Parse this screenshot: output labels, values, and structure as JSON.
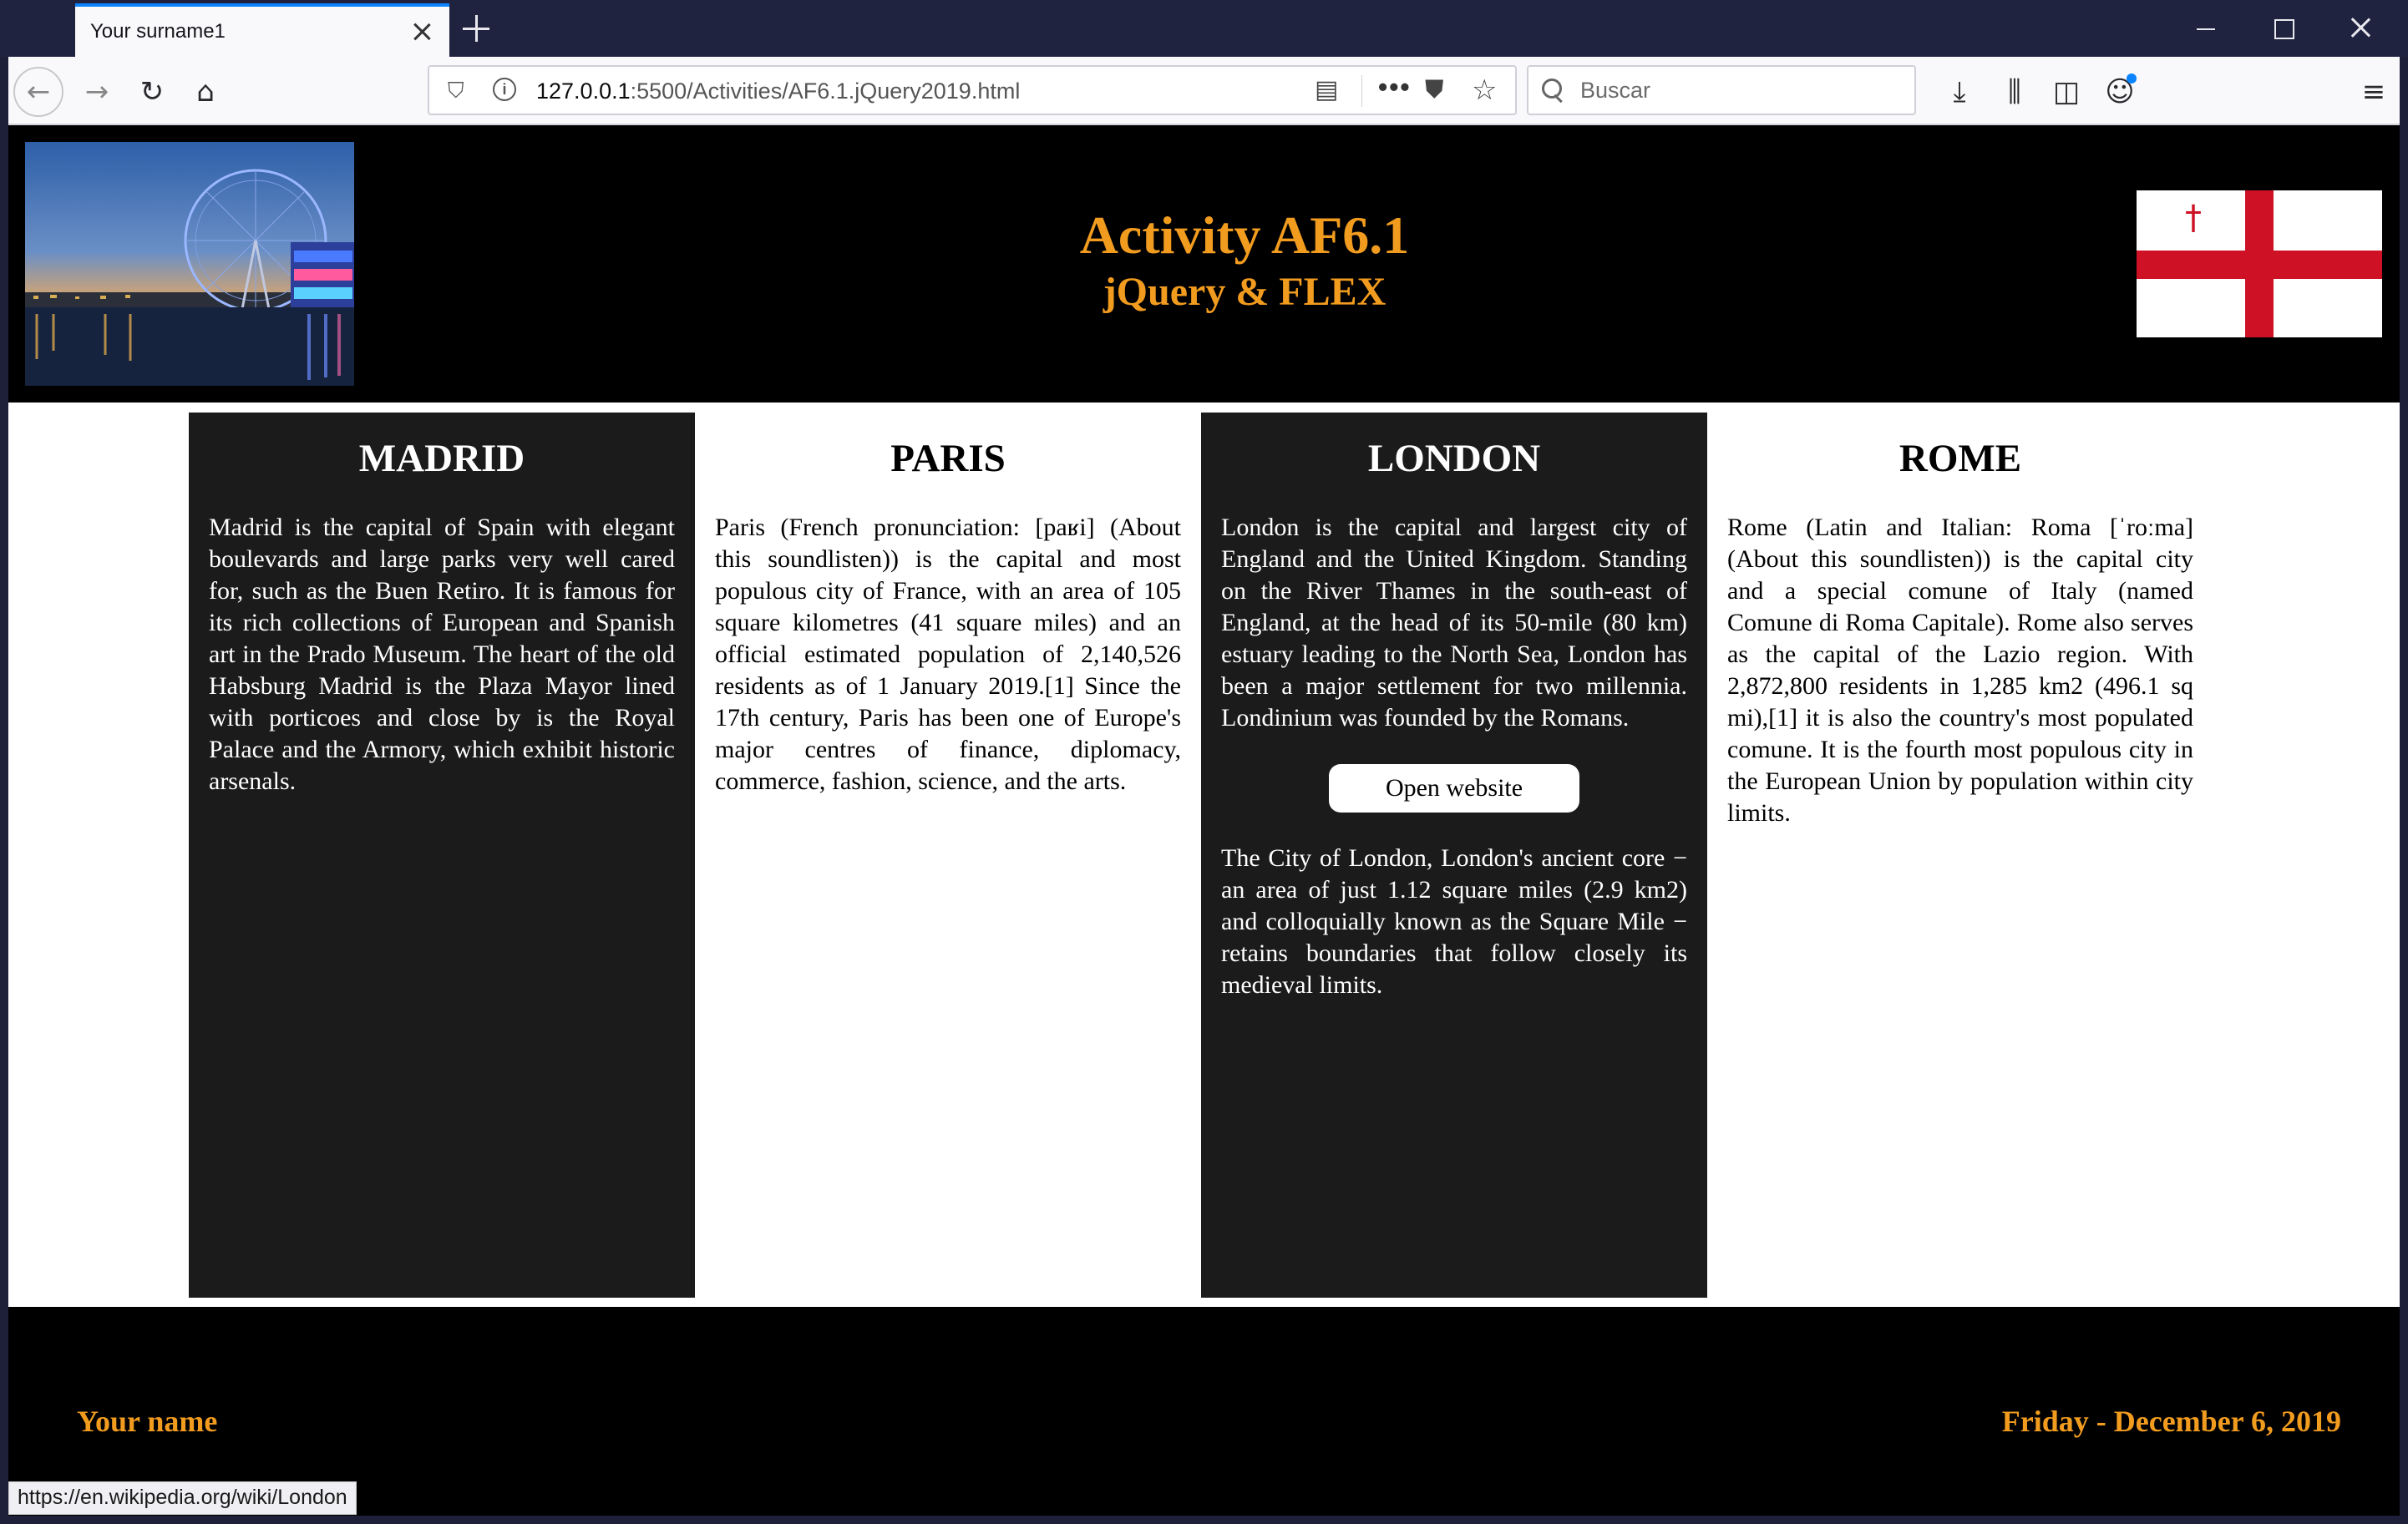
{
  "browser": {
    "tab_title": "Your surname1",
    "url_host": "127.0.0.1",
    "url_rest": ":5500/Activities/AF6.1.jQuery2019.html",
    "search_placeholder": "Buscar",
    "status_url": "https://en.wikipedia.org/wiki/London"
  },
  "header": {
    "title": "Activity AF6.1",
    "subtitle": "jQuery & FLEX"
  },
  "cards": [
    {
      "title": "MADRID",
      "text": "Madrid is the capital of Spain with elegant boulevards and large parks very well cared for, such as the Buen Retiro. It is famous for its rich collections of European and Spanish art in the Prado Museum. The heart of the old Habsburg Madrid is the Plaza Mayor lined with porticoes and close by is the Royal Palace and the Armory, which exhibit historic arsenals."
    },
    {
      "title": "PARIS",
      "text": "Paris (French pronunciation: [paʁi] (About this soundlisten)) is the capital and most populous city of France, with an area of 105 square kilometres (41 square miles) and an official estimated population of 2,140,526 residents as of 1 January 2019.[1] Since the 17th century, Paris has been one of Europe's major centres of finance, diplomacy, commerce, fashion, science, and the arts."
    },
    {
      "title": "LONDON",
      "text": "London is the capital and largest city of England and the United Kingdom. Standing on the River Thames in the south-east of England, at the head of its 50-mile (80 km) estuary leading to the North Sea, London has been a major settlement for two millennia. Londinium was founded by the Romans.",
      "button": "Open website",
      "text2": "The City of London, London's ancient core − an area of just 1.12 square miles (2.9 km2) and colloquially known as the Square Mile − retains boundaries that follow closely its medieval limits."
    },
    {
      "title": "ROME",
      "text": "Rome (Latin and Italian: Roma [ˈroːma] (About this soundlisten)) is the capital city and a special comune of Italy (named Comune di Roma Capitale). Rome also serves as the capital of the Lazio region. With 2,872,800 residents in 1,285 km2 (496.1 sq mi),[1] it is also the country's most populated comune. It is the fourth most populous city in the European Union by population within city limits."
    }
  ],
  "footer": {
    "name": "Your name",
    "date": "Friday - December 6, 2019"
  },
  "colors": {
    "accent": "#f29c1f",
    "header_bg": "#000000",
    "dark_card_bg": "#1b1b1b",
    "flag_red": "#ce1124"
  }
}
